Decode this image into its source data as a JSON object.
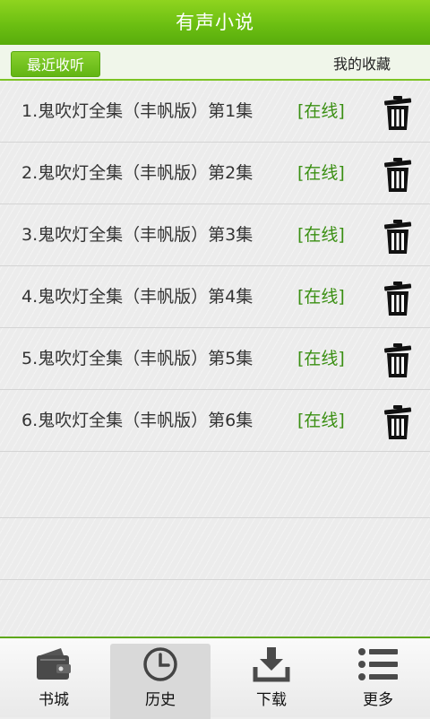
{
  "header": {
    "title": "有声小说"
  },
  "tabs": {
    "recent_label": "最近收听",
    "favorites_label": "我的收藏"
  },
  "list": {
    "items": [
      {
        "title": "1.鬼吹灯全集（丰帆版）第1集",
        "status": "[在线]"
      },
      {
        "title": "2.鬼吹灯全集（丰帆版）第2集",
        "status": "[在线]"
      },
      {
        "title": "3.鬼吹灯全集（丰帆版）第3集",
        "status": "[在线]"
      },
      {
        "title": "4.鬼吹灯全集（丰帆版）第4集",
        "status": "[在线]"
      },
      {
        "title": "5.鬼吹灯全集（丰帆版）第5集",
        "status": "[在线]"
      },
      {
        "title": "6.鬼吹灯全集（丰帆版）第6集",
        "status": "[在线]"
      }
    ]
  },
  "bottom_nav": {
    "items": [
      {
        "label": "书城",
        "icon": "wallet-icon"
      },
      {
        "label": "历史",
        "icon": "clock-icon"
      },
      {
        "label": "下载",
        "icon": "download-icon"
      },
      {
        "label": "更多",
        "icon": "list-icon"
      }
    ],
    "active": "历史"
  },
  "colors": {
    "accent": "#6cbf12",
    "status_green": "#3a8f12"
  }
}
